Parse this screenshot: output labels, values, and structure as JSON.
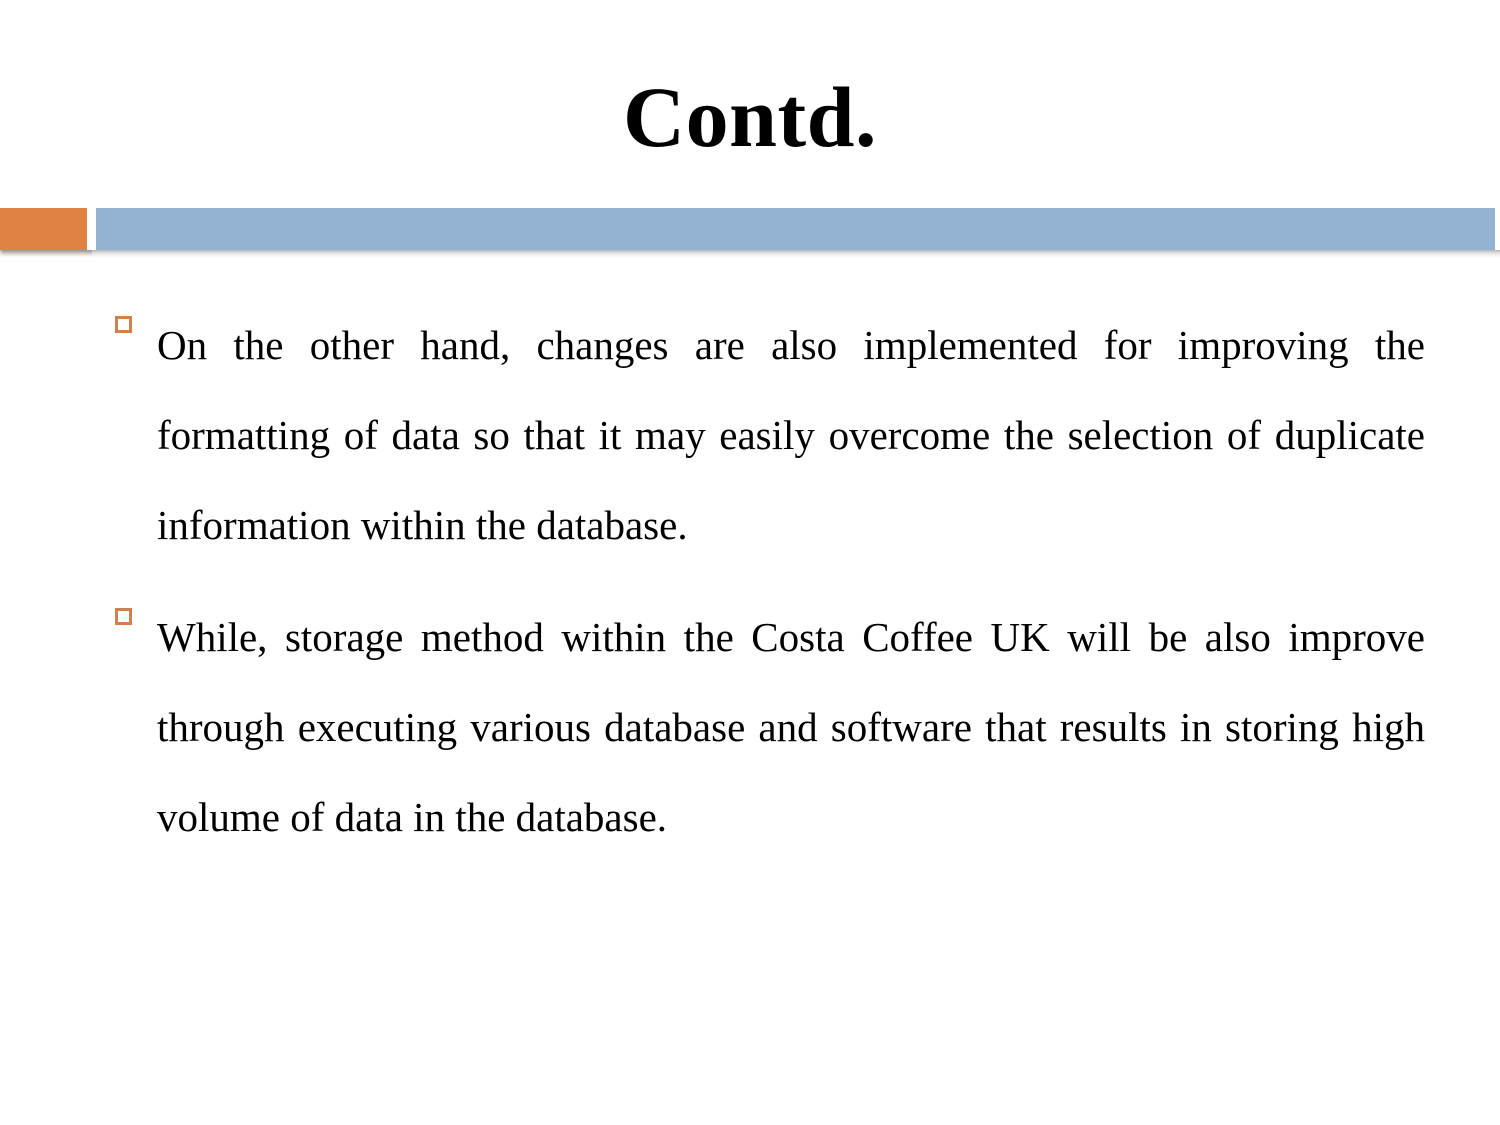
{
  "slide": {
    "title": "Contd.",
    "background_color": "#FFFFFF",
    "title_color": "#000000"
  },
  "divider": {
    "accent_color": "#DF8244",
    "bar_color": "#93B3D1"
  },
  "bullets": {
    "marker_color": "#CE8252",
    "marker_shape": "hollow-square",
    "items": [
      {
        "text": "On the other hand, changes are also implemented for improving the formatting of data so that it may easily overcome the selection of duplicate information within the database."
      },
      {
        "text": "While, storage method within the Costa Coffee UK will be also improve through executing various database and software that results in storing high volume of data in the database."
      }
    ]
  }
}
